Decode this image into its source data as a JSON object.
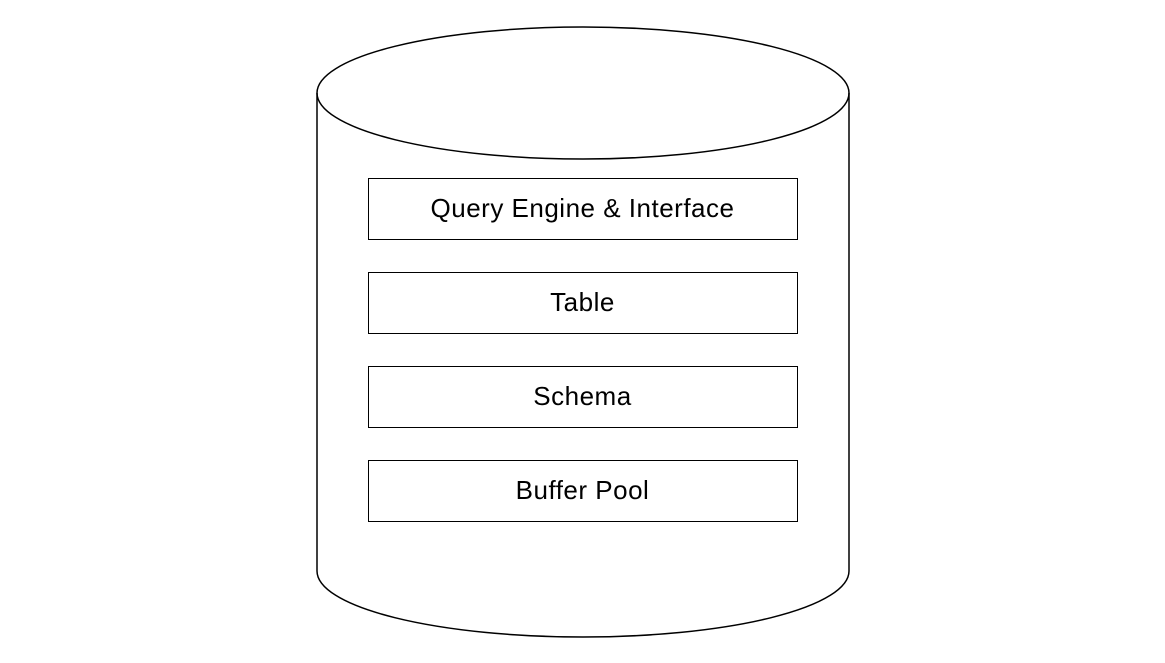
{
  "diagram": {
    "layers": [
      {
        "label": "Query Engine & Interface"
      },
      {
        "label": "Table"
      },
      {
        "label": "Schema"
      },
      {
        "label": "Buffer Pool"
      }
    ]
  }
}
